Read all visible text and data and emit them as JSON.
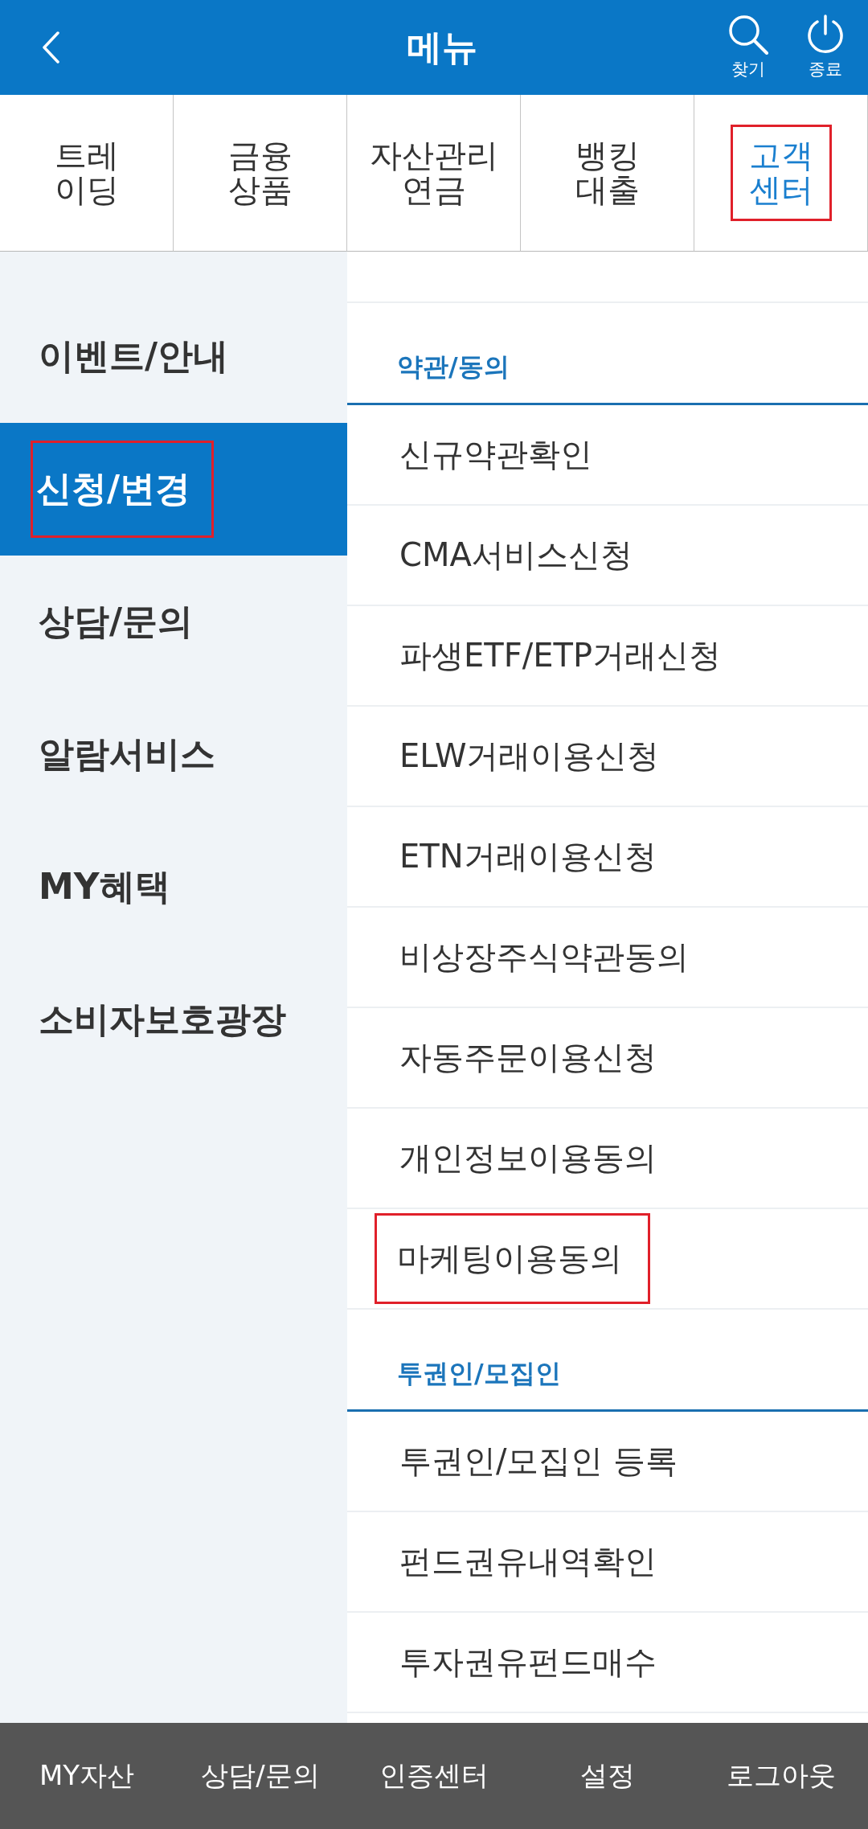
{
  "header": {
    "title": "메뉴",
    "actions": [
      {
        "kind": "search",
        "label": "찾기"
      },
      {
        "kind": "power",
        "label": "종료"
      }
    ]
  },
  "tabs": [
    {
      "lines": [
        "트레",
        "이딩"
      ],
      "selected": false,
      "highlighted": false
    },
    {
      "lines": [
        "금융",
        "상품"
      ],
      "selected": false,
      "highlighted": false
    },
    {
      "lines": [
        "자산관리",
        "연금"
      ],
      "selected": false,
      "highlighted": false
    },
    {
      "lines": [
        "뱅킹",
        "대출"
      ],
      "selected": false,
      "highlighted": false
    },
    {
      "lines": [
        "고객",
        "센터"
      ],
      "selected": true,
      "highlighted": true
    }
  ],
  "sidebar": {
    "items": [
      {
        "label": "이벤트/안내",
        "selected": false,
        "highlighted": false
      },
      {
        "label": "신청/변경",
        "selected": true,
        "highlighted": true
      },
      {
        "label": "상담/문의",
        "selected": false,
        "highlighted": false
      },
      {
        "label": "알람서비스",
        "selected": false,
        "highlighted": false
      },
      {
        "label": "MY혜택",
        "selected": false,
        "highlighted": false
      },
      {
        "label": "소비자보호광장",
        "selected": false,
        "highlighted": false
      }
    ]
  },
  "content": {
    "sections": [
      {
        "title": "약관/동의",
        "items": [
          {
            "label": "신규약관확인",
            "highlighted": false
          },
          {
            "label": "CMA서비스신청",
            "highlighted": false
          },
          {
            "label": "파생ETF/ETP거래신청",
            "highlighted": false
          },
          {
            "label": "ELW거래이용신청",
            "highlighted": false
          },
          {
            "label": "ETN거래이용신청",
            "highlighted": false
          },
          {
            "label": "비상장주식약관동의",
            "highlighted": false
          },
          {
            "label": "자동주문이용신청",
            "highlighted": false
          },
          {
            "label": "개인정보이용동의",
            "highlighted": false
          },
          {
            "label": "마케팅이용동의",
            "highlighted": true
          }
        ]
      },
      {
        "title": "투권인/모집인",
        "items": [
          {
            "label": "투권인/모집인 등록",
            "highlighted": false
          },
          {
            "label": "펀드권유내역확인",
            "highlighted": false
          },
          {
            "label": "투자권유펀드매수",
            "highlighted": false
          }
        ]
      }
    ]
  },
  "bottom_nav": {
    "items": [
      "MY자산",
      "상담/문의",
      "인증센터",
      "설정",
      "로그아웃"
    ]
  }
}
